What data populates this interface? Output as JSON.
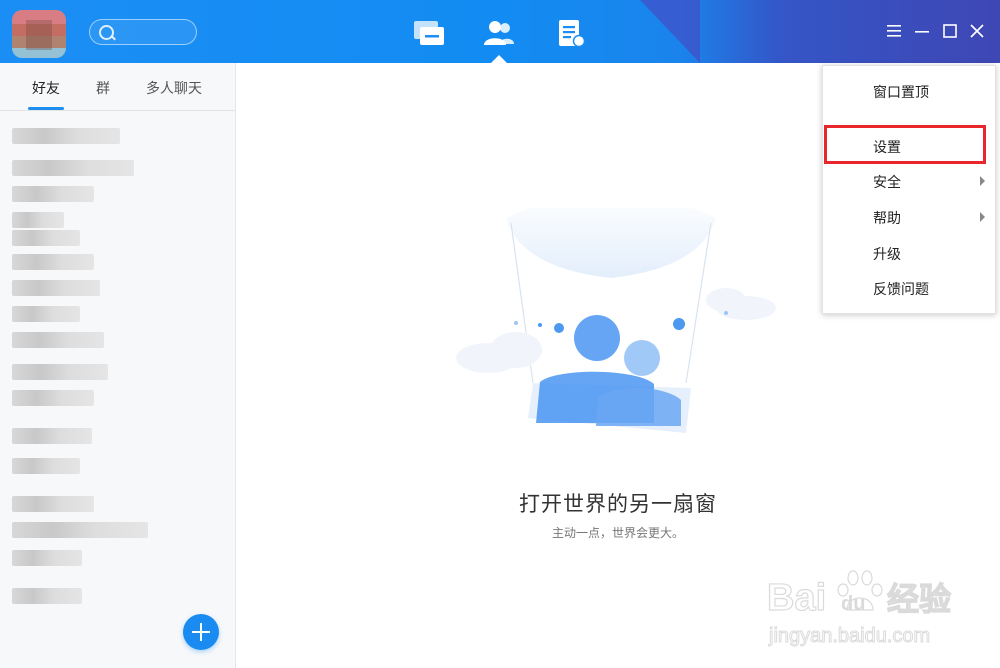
{
  "sidebar": {
    "tabs": [
      {
        "label": "好友",
        "active": true
      },
      {
        "label": "群",
        "active": false
      },
      {
        "label": "多人聊天",
        "active": false
      }
    ],
    "contacts_blurred": 15
  },
  "main": {
    "empty_title": "打开世界的另一扇窗",
    "empty_subtitle": "主动一点，世界会更大。"
  },
  "menu": {
    "items": [
      {
        "label": "窗口置顶",
        "submenu": false
      },
      {
        "label": "设置",
        "submenu": false,
        "highlighted": true
      },
      {
        "label": "安全",
        "submenu": true
      },
      {
        "label": "帮助",
        "submenu": true
      },
      {
        "label": "升级",
        "submenu": false
      },
      {
        "label": "反馈问题",
        "submenu": false
      }
    ]
  },
  "watermark": {
    "brand": "Bai",
    "brand2": "du",
    "brand_cn": "经验",
    "url": "jingyan.baidu.com"
  },
  "colors": {
    "accent": "#1a8cf1",
    "highlight_border": "#e8262b"
  }
}
